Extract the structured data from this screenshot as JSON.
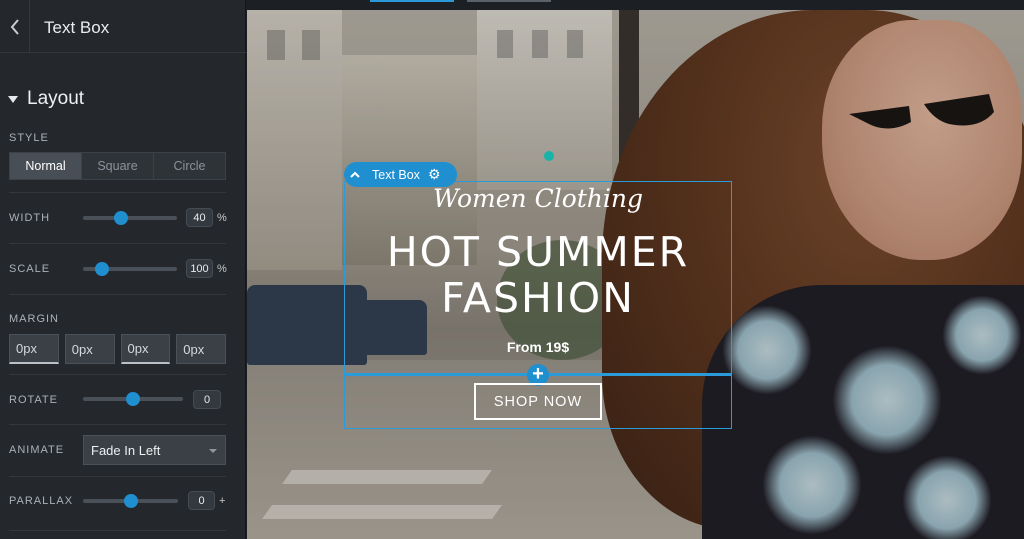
{
  "sidebar": {
    "title": "Text Box",
    "section": "Layout",
    "style": {
      "label": "STYLE",
      "options": [
        "Normal",
        "Square",
        "Circle"
      ],
      "selected": "Normal"
    },
    "width": {
      "label": "WIDTH",
      "value": "40",
      "unit": "%",
      "fraction": 0.4
    },
    "scale": {
      "label": "SCALE",
      "value": "100",
      "unit": "%",
      "fraction": 0.2
    },
    "margin": {
      "label": "MARGIN",
      "values": [
        "0px",
        "0px",
        "0px",
        "0px"
      ]
    },
    "rotate": {
      "label": "ROTATE",
      "value": "0",
      "fraction": 0.5
    },
    "animate": {
      "label": "ANIMATE",
      "value": "Fade In Left"
    },
    "parallax": {
      "label": "PARALLAX",
      "value": "0",
      "suffix": "+",
      "fraction": 0.5
    }
  },
  "canvas": {
    "element_tab": "Text Box",
    "script_heading": "Women Clothing",
    "headline_line1": "HOT SUMMER",
    "headline_line2": "FASHION",
    "price": "From 19$",
    "button": "SHOP NOW",
    "accent": "#1f8fd0"
  }
}
